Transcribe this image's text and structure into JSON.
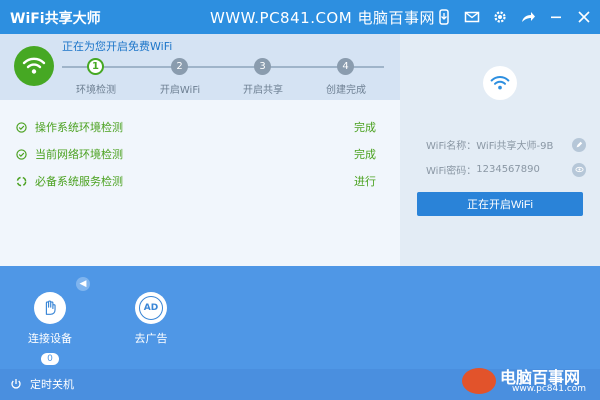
{
  "titlebar": {
    "app_title": "WiFi共享大师",
    "watermark": "WWW.PC841.COM 电脑百事网",
    "icons": [
      "download-icon",
      "mail-icon",
      "gear-icon",
      "share-icon",
      "minimize-icon",
      "close-icon"
    ]
  },
  "steps": {
    "heading": "正在为您开启免费WiFi",
    "items": [
      {
        "num": "1",
        "label": "环境检测",
        "active": true
      },
      {
        "num": "2",
        "label": "开启WiFi",
        "active": false
      },
      {
        "num": "3",
        "label": "开启共享",
        "active": false
      },
      {
        "num": "4",
        "label": "创建完成",
        "active": false
      }
    ]
  },
  "checks": [
    {
      "name": "操作系统环境检测",
      "status": "完成"
    },
    {
      "name": "当前网络环境检测",
      "status": "完成"
    },
    {
      "name": "必备系统服务检测",
      "status": "进行"
    }
  ],
  "right_panel": {
    "wifi_name_label": "WiFi名称：",
    "wifi_name_value": "WiFi共享大师-9B",
    "wifi_pwd_label": "WiFi密码：",
    "wifi_pwd_value": "1234567890",
    "start_button": "正在开启WiFi"
  },
  "bottom": {
    "tools": [
      {
        "label": "连接设备",
        "count": "0"
      },
      {
        "label": "去广告"
      }
    ],
    "ad_icon_text": "AD",
    "timer_label": "定时关机"
  },
  "watermark": {
    "text": "电脑百事网",
    "sub": "www.pc841.com"
  },
  "colors": {
    "titlebar": "#2d8fe0",
    "green": "#46a823",
    "button": "#2a83d8",
    "bottom": "#4f97e6"
  }
}
